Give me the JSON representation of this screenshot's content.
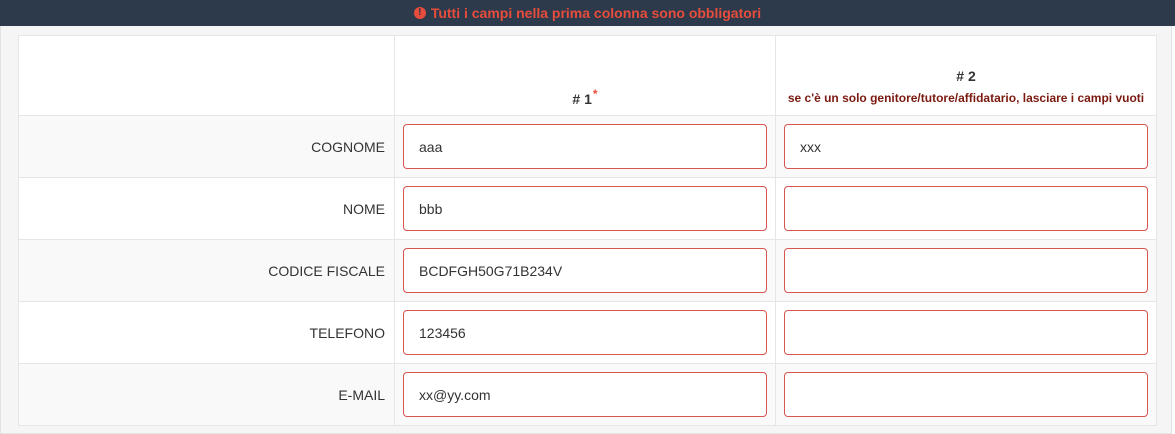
{
  "banner": {
    "icon": "exclamation-circle-icon",
    "icon_glyph": "!",
    "text": "Tutti i campi nella prima colonna sono obbligatori",
    "bg_color": "#2c3a4b",
    "text_color": "#e74c3c"
  },
  "table": {
    "columns": {
      "col1_title": "# 1",
      "col1_required_mark": "*",
      "col2_title": "# 2",
      "col2_note": "se c'è un solo genitore/tutore/affidatario, lasciare i campi vuoti"
    },
    "rows": [
      {
        "label": "COGNOME",
        "value1": "aaa",
        "value2": "xxx"
      },
      {
        "label": "NOME",
        "value1": "bbb",
        "value2": ""
      },
      {
        "label": "CODICE FISCALE",
        "value1": "BCDFGH50G71B234V",
        "value2": ""
      },
      {
        "label": "TELEFONO",
        "value1": "123456",
        "value2": ""
      },
      {
        "label": "E-MAIL",
        "value1": "xx@yy.com",
        "value2": ""
      }
    ],
    "input_border_color": "#d9534f"
  }
}
